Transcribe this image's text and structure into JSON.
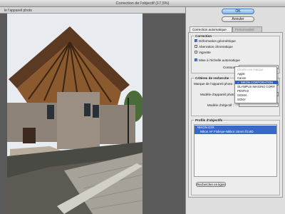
{
  "window": {
    "title": "Correction de l'objectif (17,5%)"
  },
  "preview": {
    "header": "le l'appareil photo"
  },
  "buttons": {
    "ok": "OK",
    "cancel": "Annuler"
  },
  "tabs": [
    {
      "label": "Correction automatique",
      "active": true
    },
    {
      "label": "Personnalisé",
      "active": false
    }
  ],
  "correction": {
    "title": "Correction",
    "options": [
      {
        "label": "Déformation géométrique",
        "checked": true
      },
      {
        "label": "Aberration chromatique",
        "checked": false
      },
      {
        "label": "Vignette",
        "checked": false
      }
    ],
    "auto_scale": {
      "label": "Mise à l'échelle automatique",
      "checked": true
    },
    "contour_label": "Contour :",
    "contour_value": "Contour"
  },
  "search": {
    "title": "Critères de recherche",
    "fields": [
      {
        "label": "Marque de l'appareil photo :",
        "value": "NIKON CORPORATION"
      },
      {
        "label": "Modèle d'appareil photo :",
        "value": ""
      },
      {
        "label": "Modèle d'objectif :",
        "value": ""
      }
    ]
  },
  "brand_menu": {
    "items": [
      {
        "label": "Choisir une marque",
        "state": "disabled"
      },
      {
        "label": "Apple",
        "state": "normal"
      },
      {
        "label": "Canon",
        "state": "normal"
      },
      {
        "label": "NIKON CORPORATION",
        "state": "selected"
      },
      {
        "label": "OLYMPUS IMAGING CORP.",
        "state": "normal"
      },
      {
        "label": "PENTAX",
        "state": "normal"
      },
      {
        "label": "SIGMA",
        "state": "normal"
      },
      {
        "label": "SONY",
        "state": "normal"
      }
    ]
  },
  "profiles": {
    "title": "Profils d'objectifs",
    "rows": [
      {
        "label": "NIKON D3X"
      },
      {
        "label": "Nikon AF Fisheye-Nikkor 16mm f/2.8D"
      }
    ],
    "online_button": "Rechercher en ligne"
  },
  "colors": {
    "selection": "#2f5fc4",
    "panel": "#dedede",
    "primary_button": "#7db1ee"
  }
}
